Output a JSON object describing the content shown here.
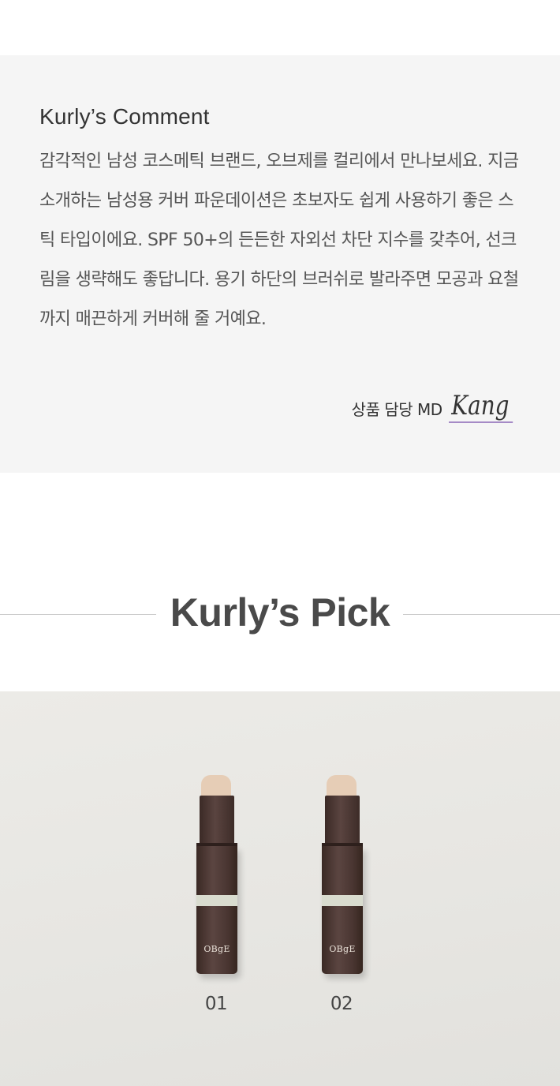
{
  "comment": {
    "title": "Kurly’s Comment",
    "body": "감각적인 남성 코스메틱 브랜드, 오브제를 컬리에서 만나보세요. 지금 소개하는 남성용 커버 파운데이션은 초보자도 쉽게 사용하기 좋은 스틱 타입이에요. SPF 50+의 든든한 자외선 차단 지수를 갖추어, 선크림을 생략해도 좋답니다. 용기 하단의 브러쉬로 발라주면 모공과 요철까지 매끈하게 커버해 줄 거예요.",
    "signature_role": "상품 담당 MD",
    "signature_name": "Kang"
  },
  "pick": {
    "title": "Kurly’s Pick",
    "products": [
      {
        "label": "01",
        "brand": "OBgE"
      },
      {
        "label": "02",
        "brand": "OBgE"
      }
    ]
  },
  "colors": {
    "comment_background": "#f5f5f5",
    "signature_underline": "#a58ac6",
    "product_body": "#4a3632",
    "product_shade": "#e6cdb6"
  }
}
